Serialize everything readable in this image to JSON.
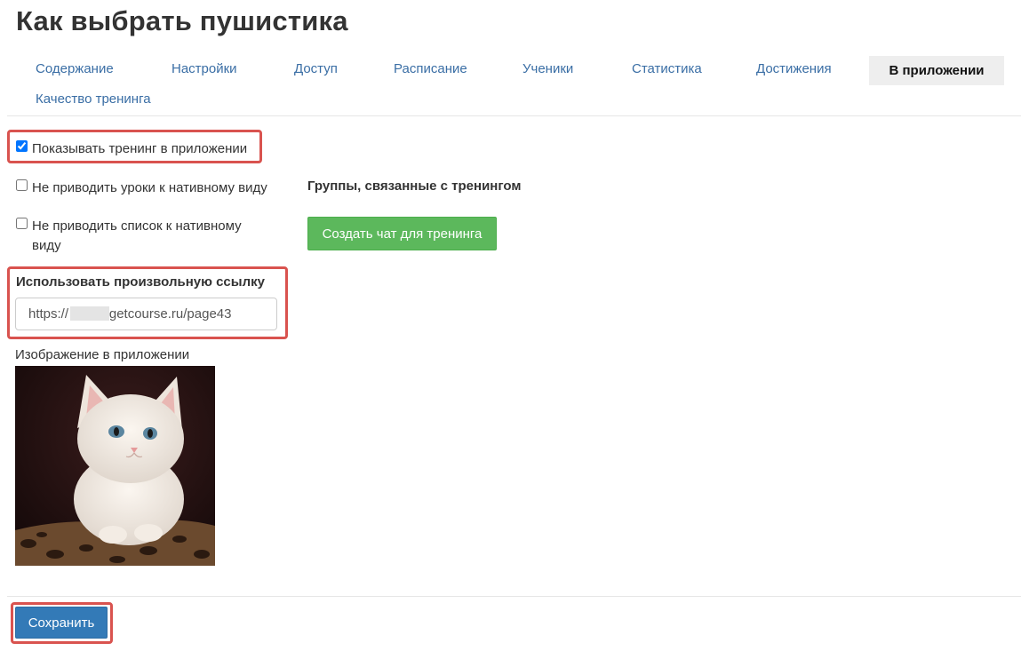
{
  "page": {
    "title": "Как выбрать пушистика"
  },
  "tabs": [
    {
      "label": "Содержание"
    },
    {
      "label": "Настройки"
    },
    {
      "label": "Доступ"
    },
    {
      "label": "Расписание"
    },
    {
      "label": "Ученики"
    },
    {
      "label": "Статистика"
    },
    {
      "label": "Достижения"
    },
    {
      "label": "В приложении",
      "active": true
    },
    {
      "label": "Качество тренинга"
    }
  ],
  "settings": {
    "show_in_app": {
      "label": "Показывать тренинг в приложении",
      "checked": true
    },
    "native_lessons": {
      "label": "Не приводить уроки к нативному виду",
      "checked": false
    },
    "native_list": {
      "label": "Не приводить список к нативному виду",
      "checked": false
    },
    "custom_link": {
      "label": "Использовать произвольную ссылку",
      "value": "https://          .getcourse.ru/page43"
    },
    "app_image": {
      "label": "Изображение в приложении",
      "alt": "kitten-photo"
    }
  },
  "groups": {
    "label": "Группы, связанные с тренингом",
    "create_chat_button": "Создать чат для тренинга"
  },
  "footer": {
    "save_button": "Сохранить"
  },
  "colors": {
    "link": "#3a6ea5",
    "highlight": "#d9534f",
    "success": "#5cb85c",
    "primary": "#337ab7"
  }
}
